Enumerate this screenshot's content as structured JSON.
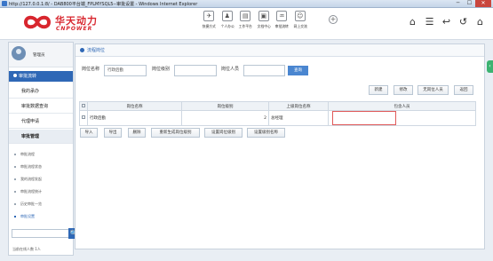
{
  "window": {
    "title": "http://127.0.0.1:8/ - DAB800平台端_FPLMYSQL5--审批设置 - Windows Internet Explorer",
    "min": "─",
    "max": "☐",
    "close": "✕"
  },
  "brand": {
    "cn": "华天动力",
    "en": "CNPOWER",
    "color": "#d8262e"
  },
  "topnav": [
    {
      "label": "快捷方式",
      "icon": "✈"
    },
    {
      "label": "个人办公",
      "icon": "♟"
    },
    {
      "label": "工作平台",
      "icon": "▤"
    },
    {
      "label": "文档中心",
      "icon": "▣"
    },
    {
      "label": "审批流转",
      "icon": "♒"
    },
    {
      "label": "网上交流",
      "icon": "☺"
    }
  ],
  "top_plus": "+",
  "right_icons": [
    "⌂",
    "☰",
    "↩",
    "↺",
    "⌂"
  ],
  "sidebar": {
    "username": "管理员",
    "menu_head": "审批流转",
    "items": [
      "我的承办",
      "审批数据查询",
      "代理申请",
      "审批管理"
    ],
    "subitems": [
      "审批流程",
      "审批流程状态",
      "我的流程发起",
      "审批流程统计",
      "历史审批一览",
      "审批设置"
    ],
    "search_icon": "🔍",
    "online": "当前在线人数 1人"
  },
  "main": {
    "breadcrumb": "流程岗位",
    "filters": {
      "name_label": "岗位名称",
      "name_value": "行政后勤",
      "level_label": "岗位级别",
      "level_value": "",
      "person_label": "岗位人员",
      "person_value": "",
      "query_button": "查询"
    },
    "toolbar": {
      "new": "新建",
      "modify": "修改",
      "no_person": "无岗位人员",
      "back": "返回"
    },
    "table": {
      "headers": [
        "岗位名称",
        "岗位级别",
        "上级岗位名称",
        "包含人员"
      ],
      "rows": [
        {
          "name": "行政后勤",
          "level": "2",
          "parent": "总经理",
          "members": ""
        }
      ]
    },
    "bottom_buttons": [
      "导入",
      "导出",
      "删除",
      "重新生成岗位级别",
      "设置岗位级别",
      "设置级别名称"
    ]
  },
  "colors": {
    "accent": "#2f68b6",
    "query": "#4a86d0",
    "error_outline": "#e05a5a"
  }
}
